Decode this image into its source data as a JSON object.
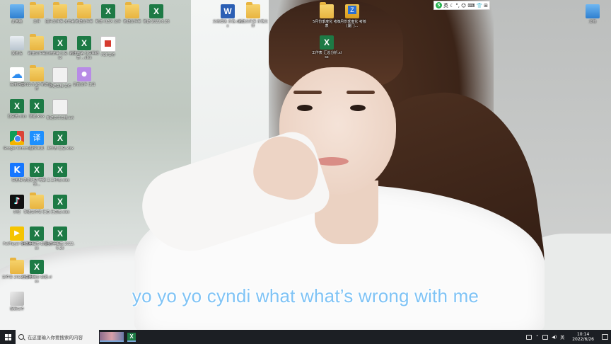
{
  "desktop": {
    "icons": [
      {
        "label": "此电脑",
        "icon": "this-pc-icon"
      },
      {
        "label": "文件",
        "icon": "folder-icon"
      },
      {
        "label": "图片文件夹 未命名",
        "icon": "folder-icon"
      },
      {
        "label": "新建文件夹",
        "icon": "folder-icon"
      },
      {
        "label": "新建 XLSX 文件",
        "icon": "excel-icon"
      },
      {
        "label": "新建文件夹",
        "icon": "folder-icon"
      },
      {
        "label": "新建 2022.6.26",
        "icon": "excel-icon"
      },
      {
        "label": "回收站",
        "icon": "recycle-bin-icon"
      },
      {
        "label": "新建文件夹",
        "icon": "folder-icon"
      },
      {
        "label": "文档表格 汇总 ...xlsx",
        "icon": "excel-icon"
      },
      {
        "label": "新建表格 汇总明细表 ...xlsx",
        "icon": "excel-icon"
      },
      {
        "label": "PDF文件",
        "icon": "pdf-icon"
      },
      {
        "label": "百度网盘",
        "icon": "baidu-netdisk-icon"
      },
      {
        "label": "2022.6.26 新建文件",
        "icon": "folder-icon"
      },
      {
        "label": "新建文档 文件",
        "icon": "document-icon"
      },
      {
        "label": "录音文件 工具",
        "icon": "microphone-icon"
      },
      {
        "label": "汇总表.xlsx",
        "icon": "excel-icon"
      },
      {
        "label": "数据.xlsx",
        "icon": "excel-icon"
      },
      {
        "label": "新建文本文档.txt",
        "icon": "document-icon"
      },
      {
        "label": "Google Chrome",
        "icon": "chrome-icon"
      },
      {
        "label": "翻译工具",
        "icon": "translate-icon"
      },
      {
        "label": "工作表 汇总.xlsx",
        "icon": "excel-icon"
      },
      {
        "label": "快剪辑",
        "icon": "k-app-icon"
      },
      {
        "label": "表格汇总 明细 工作...",
        "icon": "excel-icon"
      },
      {
        "label": "工作表.xlsx",
        "icon": "excel-icon"
      },
      {
        "label": "抖音",
        "icon": "tiktok-icon"
      },
      {
        "label": "新建文件夹 汇总",
        "icon": "folder-icon"
      },
      {
        "label": "汇总表.xlsx",
        "icon": "excel-icon"
      },
      {
        "label": "PotPlayer 64 bit",
        "icon": "potplayer-icon"
      },
      {
        "label": "汇总明细表 数据.xlsx",
        "icon": "excel-icon"
      },
      {
        "label": "汇总明细表 2022.6.26",
        "icon": "excel-icon"
      },
      {
        "label": "文件夹 2022.6.26",
        "icon": "folder-icon"
      },
      {
        "label": "汇总明细表 数据.xlsx",
        "icon": "excel-icon"
      },
      {
        "label": "视频文件",
        "icon": "video-file-icon"
      },
      {
        "label": "文档模板 示范.docx",
        "icon": "word-icon"
      },
      {
        "label": "新建文件夹 示范文件",
        "icon": "folder-icon"
      },
      {
        "label": "5月份季度化 考核表",
        "icon": "folder-icon"
      },
      {
        "label": "5月份季度化 考核(厦门...",
        "icon": "zip-icon"
      },
      {
        "label": "工作表 汇总分析.xlsx",
        "icon": "excel-icon"
      },
      {
        "label": "文档",
        "icon": "user-folder-icon"
      }
    ]
  },
  "ime": {
    "logo": "S",
    "mode": "英",
    "symbols": [
      "☾",
      "°,",
      "☺",
      "⌨",
      "👕",
      "⊞"
    ]
  },
  "subtitle": {
    "text": "yo yo yo cyndi what what’s wrong with me"
  },
  "taskbar": {
    "search_placeholder": "在这里输入你要搜索的内容",
    "excel_label": "X",
    "tray_ime": "英",
    "time": "10:14",
    "date": "2022/6/26"
  }
}
